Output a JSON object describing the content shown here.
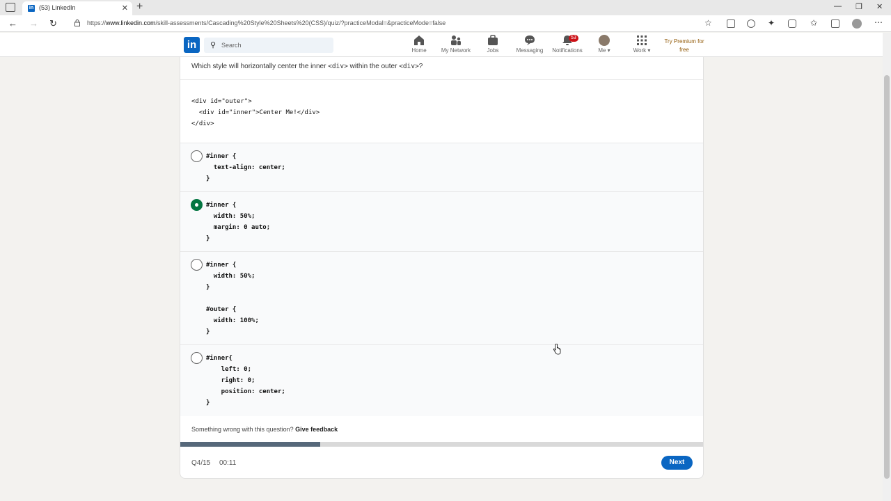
{
  "browser": {
    "tab_title": "(53) LinkedIn",
    "url_prefix": "https://",
    "url_host": "www.linkedin.com",
    "url_path": "/skill-assessments/Cascading%20Style%20Sheets%20(CSS)/quiz/?practiceModal=&practiceMode=false",
    "favicon_text": "in"
  },
  "header": {
    "logo": "in",
    "search_placeholder": "Search",
    "nav": [
      {
        "label": "Home",
        "icon": "home-icon"
      },
      {
        "label": "My Network",
        "icon": "network-icon"
      },
      {
        "label": "Jobs",
        "icon": "briefcase-icon"
      },
      {
        "label": "Messaging",
        "icon": "chat-icon"
      },
      {
        "label": "Notifications",
        "icon": "bell-icon",
        "badge": "53"
      },
      {
        "label": "Me",
        "icon": "avatar"
      },
      {
        "label": "Work",
        "icon": "grid-icon"
      }
    ],
    "premium_line1": "Try Premium for",
    "premium_line2": "free"
  },
  "quiz": {
    "question_prefix": "Which style will horizontally center the inner ",
    "question_code1": "<div>",
    "question_mid": " within the outer ",
    "question_code2": "<div>",
    "question_suffix": "?",
    "question_code_block": "<div id=\"outer\">\n  <div id=\"inner\">Center Me!</div>\n</div>",
    "options": [
      {
        "code": "#inner {\n  text-align: center;\n}",
        "selected": false
      },
      {
        "code": "#inner {\n  width: 50%;\n  margin: 0 auto;\n}",
        "selected": true
      },
      {
        "code": "#inner {\n  width: 50%;\n}\n\n#outer {\n  width: 100%;\n}",
        "selected": false
      },
      {
        "code": "#inner{\n    left: 0;\n    right: 0;\n    position: center;\n}",
        "selected": false
      }
    ],
    "feedback_text": "Something wrong with this question? ",
    "feedback_link": "Give feedback",
    "progress_fraction": 0.267,
    "question_number": "Q4/15",
    "timer": "00:11",
    "next_label": "Next"
  },
  "colors": {
    "linkedin_blue": "#0a66c2",
    "selected_green": "#057642",
    "badge_red": "#cc1016",
    "progress_fill": "#56687a"
  }
}
